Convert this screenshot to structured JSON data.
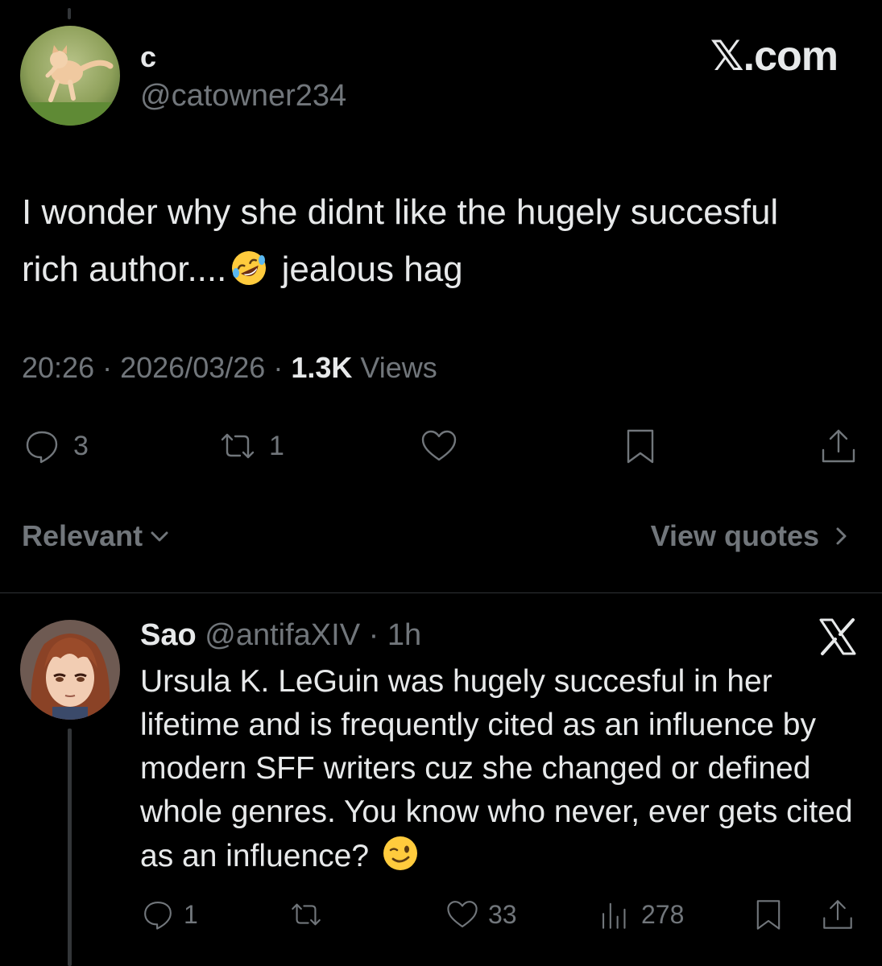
{
  "tweet": {
    "display_name": "c",
    "handle": "@catowner234",
    "text_line1": "I wonder why she didnt like the hugely succesful",
    "text_line2_before": "rich author....",
    "text_line2_after": " jealous hag",
    "time": "20:26",
    "date": "2026/03/26",
    "views_count": "1.3K",
    "views_label": "Views",
    "replies": "3",
    "reposts": "1"
  },
  "brand": "𝕏.com",
  "sort": {
    "label": "Relevant",
    "view_quotes": "View quotes"
  },
  "reply": {
    "display_name": "Sao",
    "handle": "@antifaXIV",
    "time": "1h",
    "text": "Ursula K. LeGuin was hugely succesful in her lifetime and is frequently cited as an influence by modern SFF writers cuz she changed or defined whole genres. You know who never, ever gets cited as an influence?",
    "replies": "1",
    "likes": "33",
    "views": "278"
  },
  "colors": {
    "background": "#000000",
    "text_primary": "#e7e9ea",
    "text_secondary": "#71767b",
    "divider": "#2f3336"
  },
  "icons": [
    "reply-icon",
    "repost-icon",
    "like-icon",
    "bookmark-icon",
    "share-icon",
    "views-icon",
    "x-logo-icon",
    "chevron-down-icon",
    "chevron-right-icon",
    "rofl-emoji-icon",
    "wink-emoji-icon"
  ]
}
